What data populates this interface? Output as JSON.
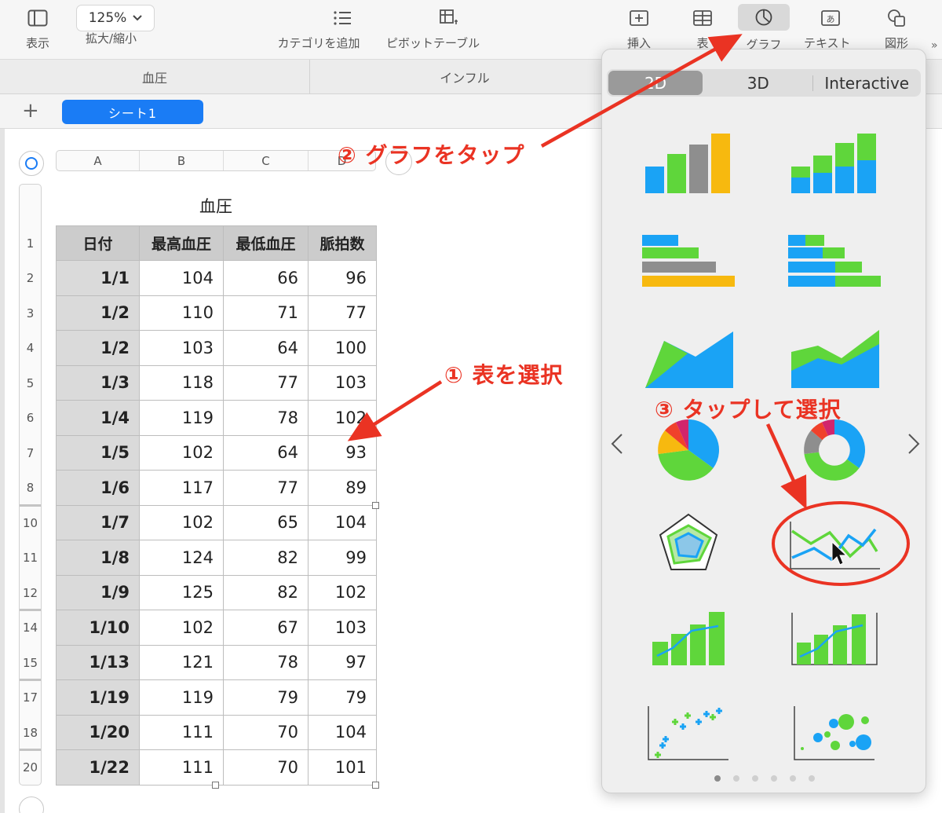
{
  "toolbar": {
    "view_label": "表示",
    "zoom_value": "125%",
    "zoom_label": "拡大/縮小",
    "add_category_label": "カテゴリを追加",
    "pivot_label": "ピボットテーブル",
    "insert_label": "挿入",
    "table_label": "表",
    "chart_label": "グラフ",
    "text_label": "テキスト",
    "shape_label": "図形"
  },
  "doc_tabs": [
    "血圧",
    "インフル"
  ],
  "sheet": {
    "add_symbol": "+",
    "tab_label": "シート1"
  },
  "column_headers": [
    "A",
    "B",
    "C",
    "D"
  ],
  "row_headers": [
    "1",
    "2",
    "3",
    "4",
    "5",
    "6",
    "7",
    "8",
    "10",
    "11",
    "12",
    "14",
    "15",
    "17",
    "18",
    "20"
  ],
  "table": {
    "title": "血圧",
    "headers": [
      "日付",
      "最高血圧",
      "最低血圧",
      "脈拍数"
    ],
    "rows": [
      [
        "1/1",
        "104",
        "66",
        "96"
      ],
      [
        "1/2",
        "110",
        "71",
        "77"
      ],
      [
        "1/2",
        "103",
        "64",
        "100"
      ],
      [
        "1/3",
        "118",
        "77",
        "103"
      ],
      [
        "1/4",
        "119",
        "78",
        "102"
      ],
      [
        "1/5",
        "102",
        "64",
        "93"
      ],
      [
        "1/6",
        "117",
        "77",
        "89"
      ],
      [
        "1/7",
        "102",
        "65",
        "104"
      ],
      [
        "1/8",
        "124",
        "82",
        "99"
      ],
      [
        "1/9",
        "125",
        "82",
        "102"
      ],
      [
        "1/10",
        "102",
        "67",
        "103"
      ],
      [
        "1/13",
        "121",
        "78",
        "97"
      ],
      [
        "1/19",
        "119",
        "79",
        "79"
      ],
      [
        "1/20",
        "111",
        "70",
        "104"
      ],
      [
        "1/22",
        "111",
        "70",
        "101"
      ]
    ]
  },
  "annotations": {
    "step1": "① 表を選択",
    "step2": "② グラフをタップ",
    "step3": "③ タップして選択",
    "color": "#ea3323"
  },
  "chart_picker": {
    "segments": [
      "2D",
      "3D",
      "Interactive"
    ],
    "active_segment": "2D",
    "chart_types": [
      {
        "name": "column-chart",
        "icon": "column-chart-icon"
      },
      {
        "name": "stacked-column-chart",
        "icon": "stacked-column-chart-icon"
      },
      {
        "name": "bar-chart",
        "icon": "bar-chart-icon"
      },
      {
        "name": "stacked-bar-chart",
        "icon": "stacked-bar-chart-icon"
      },
      {
        "name": "area-chart",
        "icon": "area-chart-icon"
      },
      {
        "name": "stacked-area-chart",
        "icon": "stacked-area-chart-icon"
      },
      {
        "name": "pie-chart",
        "icon": "pie-chart-icon"
      },
      {
        "name": "donut-chart",
        "icon": "donut-chart-icon"
      },
      {
        "name": "radar-chart",
        "icon": "radar-chart-icon"
      },
      {
        "name": "line-chart",
        "icon": "line-chart-icon"
      },
      {
        "name": "mixed-chart",
        "icon": "mixed-chart-icon"
      },
      {
        "name": "two-axis-chart",
        "icon": "two-axis-chart-icon"
      },
      {
        "name": "scatter-chart",
        "icon": "scatter-chart-icon"
      },
      {
        "name": "bubble-chart",
        "icon": "bubble-chart-icon"
      }
    ],
    "page_count": 6,
    "active_page": 1,
    "colors": {
      "blue": "#1aa3f5",
      "green": "#5fd63b",
      "gray": "#8e8e8e",
      "yellow": "#f7b90f",
      "red": "#f0412b",
      "magenta": "#d1256c"
    }
  },
  "accent_color": "#1a7cf5"
}
